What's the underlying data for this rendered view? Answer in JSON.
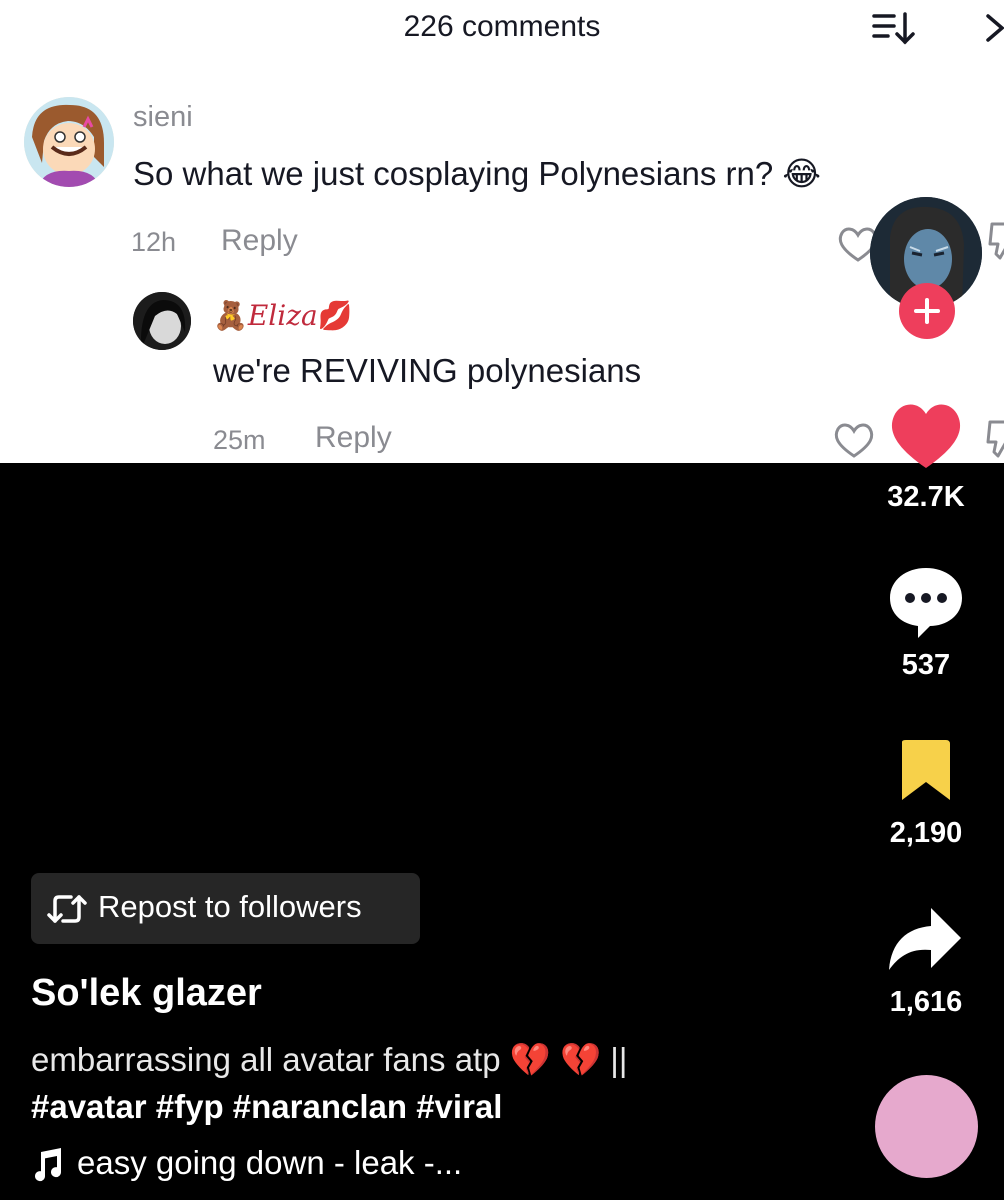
{
  "comments_panel": {
    "title": "226 comments",
    "comments": [
      {
        "username": "sieni",
        "text": "So what we just cosplaying Polynesians rn? 😂",
        "time": "12h",
        "reply_label": "Reply"
      },
      {
        "username": "🧸𝐸𝑙𝑖𝑧𝑎💋",
        "text": "we're REVIVING polynesians",
        "time": "25m",
        "reply_label": "Reply"
      }
    ]
  },
  "actions": {
    "likes": "32.7K",
    "comments": "537",
    "saves": "2,190",
    "shares": "1,616"
  },
  "video": {
    "repost_label": "Repost to followers",
    "author": "So'lek glazer",
    "caption": "embarrassing all avatar fans atp 💔 💔 ||",
    "hashtags": "#avatar #fyp #naranclan #viral",
    "music": "easy going down - leak -..."
  },
  "colors": {
    "like_red": "#ee3e5c",
    "save_yellow": "#f7d14a",
    "disc_pink": "#e6a9cd"
  },
  "icons": [
    "sort-icon",
    "close-icon",
    "heart-outline-icon",
    "dislike-icon",
    "plus-icon",
    "heart-icon",
    "comment-bubble-icon",
    "bookmark-icon",
    "share-arrow-icon",
    "repost-icon",
    "music-note-icon"
  ]
}
